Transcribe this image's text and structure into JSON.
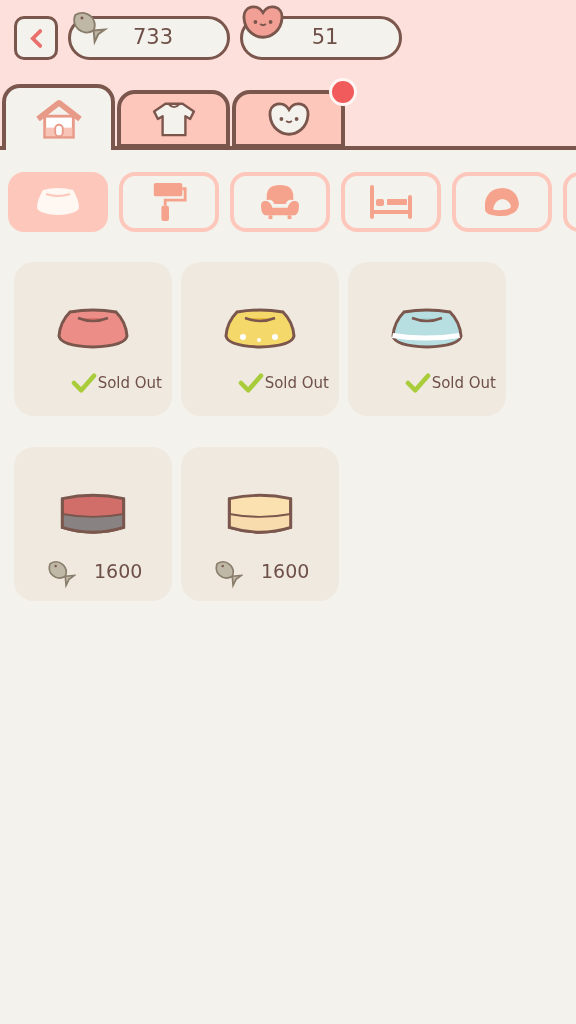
{
  "currencies": [
    {
      "kind": "fish",
      "value": "733"
    },
    {
      "kind": "heart",
      "value": "51"
    }
  ],
  "tabs": [
    {
      "kind": "house",
      "selected": true,
      "badge": false
    },
    {
      "kind": "shirt",
      "selected": false,
      "badge": false
    },
    {
      "kind": "heart",
      "selected": false,
      "badge": true
    }
  ],
  "categories": [
    {
      "kind": "bowl",
      "selected": true
    },
    {
      "kind": "roller",
      "selected": false
    },
    {
      "kind": "armchair",
      "selected": false
    },
    {
      "kind": "bed",
      "selected": false
    },
    {
      "kind": "cushion",
      "selected": false
    },
    {
      "kind": "unknown",
      "selected": false
    }
  ],
  "items": [
    {
      "kind": "sold",
      "label": "Sold Out"
    },
    {
      "kind": "sold",
      "label": "Sold Out"
    },
    {
      "kind": "sold",
      "label": "Sold Out"
    },
    {
      "kind": "price",
      "price": "1600"
    },
    {
      "kind": "price",
      "price": "1600"
    }
  ]
}
